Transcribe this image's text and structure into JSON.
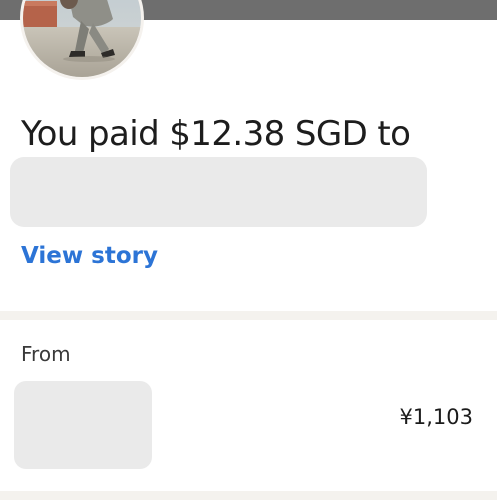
{
  "header": {
    "bar_color": "#6e6e6e"
  },
  "payment": {
    "headline": "You paid $12.38 SGD to",
    "view_story_label": "View story",
    "link_color": "#2c74d6"
  },
  "funding": {
    "from_label": "From",
    "amount": "¥1,103"
  }
}
